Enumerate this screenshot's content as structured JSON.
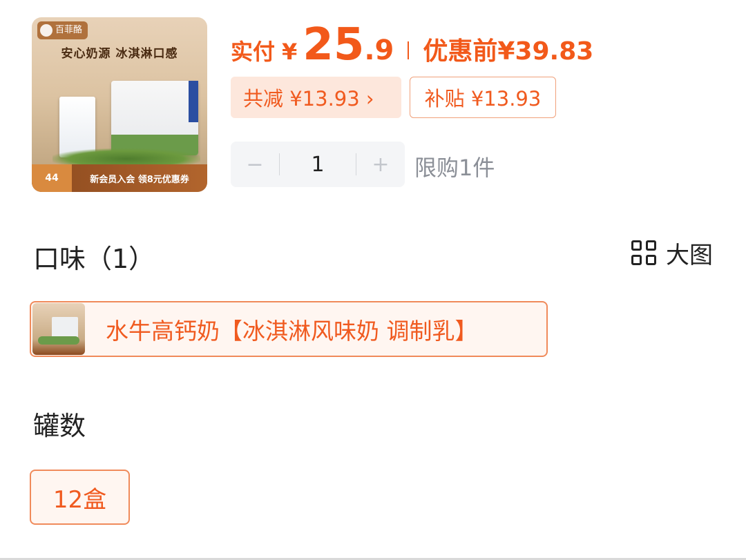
{
  "product_image": {
    "brand": "百菲酪",
    "headline": "安心奶源 冰淇淋口感",
    "footer_price": "44",
    "footer_promo": "新会员入会 领8元优惠券"
  },
  "price": {
    "paid_label": "实付",
    "currency": "¥",
    "paid_int": "25",
    "paid_dec": ".9",
    "before_label": "优惠前",
    "before_value": "¥39.83"
  },
  "discount": {
    "reduce_text": "共减 ¥13.93 ›",
    "subsidy_text": "补贴 ¥13.93"
  },
  "quantity": {
    "minus": "−",
    "value": "1",
    "plus": "+",
    "limit": "限购1件"
  },
  "flavor": {
    "title": "口味（1）",
    "big_view": "大图",
    "options": [
      {
        "label": "水牛高钙奶【冰淇淋风味奶 调制乳】"
      }
    ]
  },
  "count": {
    "title": "罐数",
    "options": [
      {
        "label": "12盒"
      }
    ]
  },
  "colors": {
    "accent": "#f2591a",
    "chip_bg": "#fde7dc",
    "selected_border": "#f08a5a"
  }
}
